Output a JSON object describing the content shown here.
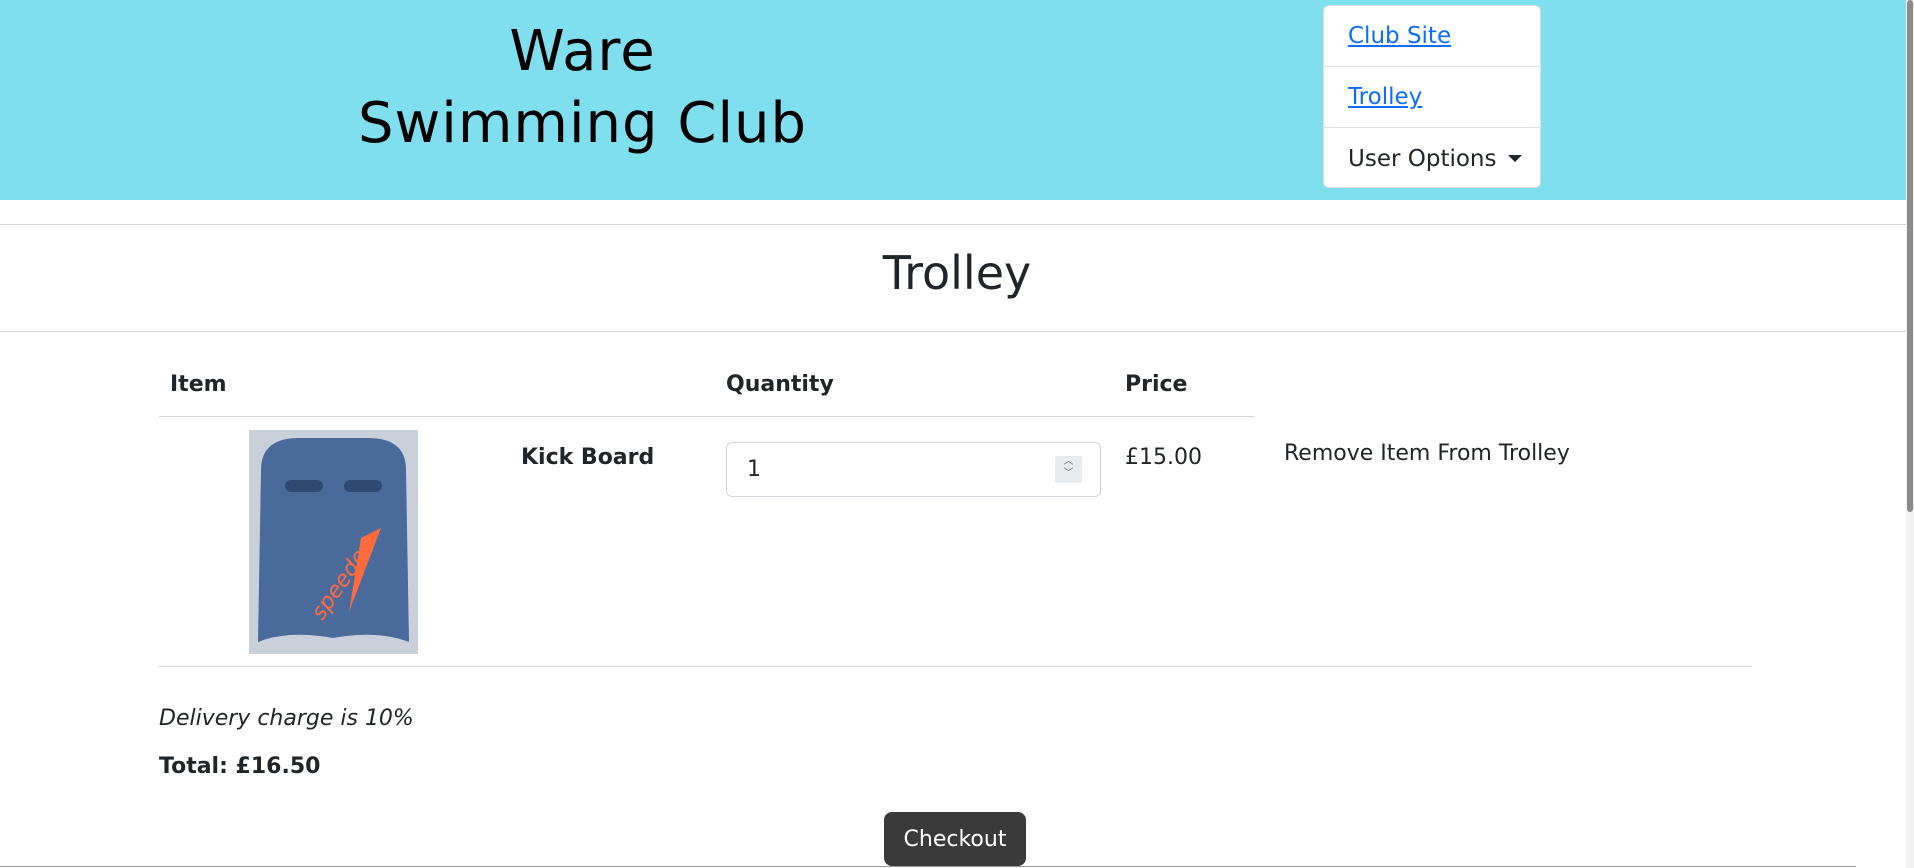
{
  "header": {
    "club_name_line1": "Ware",
    "club_name_line2": "Swimming Club",
    "background_color": "#7fdfee",
    "nav": {
      "club_site": "Club Site",
      "trolley": "Trolley",
      "user_options": "User Options"
    }
  },
  "main": {
    "title": "Trolley",
    "table": {
      "headers": [
        "Item",
        "Quantity",
        "Price"
      ],
      "rows": [
        {
          "image_brand": "speedo",
          "name": "Kick Board",
          "quantity": "1",
          "price": "£15.00",
          "remove_label": "Remove Item From Trolley"
        }
      ]
    },
    "delivery_note": "Delivery charge is 10%",
    "total": "Total: £16.50",
    "checkout_label": "Checkout"
  }
}
